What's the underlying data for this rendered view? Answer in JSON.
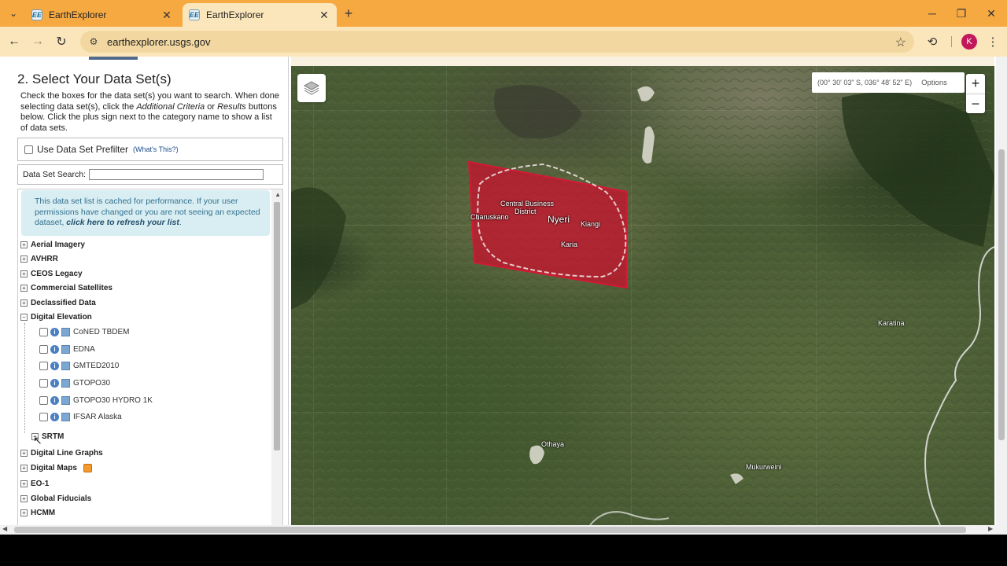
{
  "browser": {
    "tabs": [
      {
        "favicon": "EE",
        "title": "EarthExplorer",
        "active": false
      },
      {
        "favicon": "EE",
        "title": "EarthExplorer",
        "active": true
      }
    ],
    "url": "earthexplorer.usgs.gov",
    "profile_initial": "K",
    "accent_color": "#f6a941"
  },
  "left_panel": {
    "heading": "2. Select Your Data Set(s)",
    "instructions_1": "Check the boxes for the data set(s) you want to search. When done selecting data set(s), click the ",
    "instructions_em1": "Additional Criteria",
    "instructions_or": " or ",
    "instructions_em2": "Results",
    "instructions_2": " buttons below. Click the plus sign next to the category name to show a list of data sets.",
    "prefilter_label": "Use Data Set Prefilter",
    "whats_this": "(What's This?)",
    "search_label": "Data Set Search:",
    "search_value": "",
    "cache_note": "This data set list is cached for performance. If your user permissions have changed or you are not seeing an expected dataset, ",
    "cache_link": "click here to refresh your list",
    "cache_end": ".",
    "categories_top": [
      "Aerial Imagery",
      "AVHRR",
      "CEOS Legacy",
      "Commercial Satellites",
      "Declassified Data"
    ],
    "expanded_category": "Digital Elevation",
    "datasets": [
      "CoNED TBDEM",
      "EDNA",
      "GMTED2010",
      "GTOPO30",
      "GTOPO30 HYDRO 1K",
      "IFSAR Alaska"
    ],
    "subcategory": "SRTM",
    "categories_bottom": [
      "Digital Line Graphs",
      "Digital Maps",
      "EO-1",
      "Global Fiducials",
      "HCMM"
    ]
  },
  "map": {
    "coordinates": "(00° 30' 03\" S, 036° 48' 52\" E)",
    "options_label": "Options",
    "zoom_in": "+",
    "zoom_out": "−",
    "labels": {
      "cbd": "Central Business",
      "cbd2": "District",
      "nyeri": "Nyeri",
      "chaniakano": "Charuskano",
      "kiangi": "Kiangi",
      "karia": "Karia",
      "karatina": "Karatina",
      "othaya": "Othaya",
      "mukurweini": "Mukurweini"
    },
    "polygon_color": "#c8102e"
  }
}
